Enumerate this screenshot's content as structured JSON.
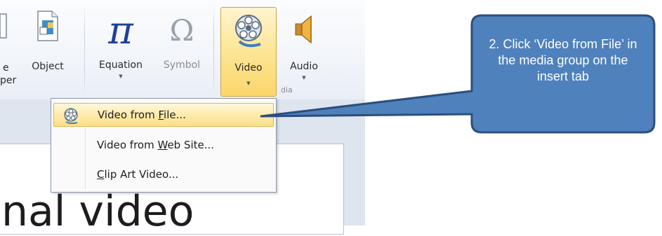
{
  "ribbon": {
    "buttons": {
      "partial_left": {
        "label_line1": "e",
        "label_line2": "per"
      },
      "object": {
        "label": "Object",
        "icon": "object-icon"
      },
      "equation": {
        "label": "Equation",
        "glyph": "π",
        "icon": "pi-icon"
      },
      "symbol": {
        "label": "Symbol",
        "glyph": "Ω",
        "icon": "omega-icon"
      },
      "video": {
        "label": "Video",
        "icon": "film-reel-icon"
      },
      "audio": {
        "label": "Audio",
        "icon": "speaker-icon"
      }
    }
  },
  "video_menu": {
    "items": [
      {
        "pre": "Video from ",
        "accel": "F",
        "post": "ile...",
        "highlighted": true,
        "icon": "film-reel-icon"
      },
      {
        "pre": "Video from ",
        "accel": "W",
        "post": "eb Site...",
        "highlighted": false
      },
      {
        "pre": "",
        "accel": "C",
        "post": "lip Art Video...",
        "highlighted": false
      }
    ]
  },
  "slide": {
    "visible_text": "nal video"
  },
  "callout": {
    "text": "2. Click ‘Video from File’ in the media group on the insert tab",
    "fill": "#4f81bd",
    "stroke": "#2c4f7c"
  },
  "colors": {
    "hover_fill": "#fde79b",
    "hover_border": "#e3b74d",
    "pi_color": "#1f3f9a",
    "omega_color": "#9aa2ad"
  }
}
